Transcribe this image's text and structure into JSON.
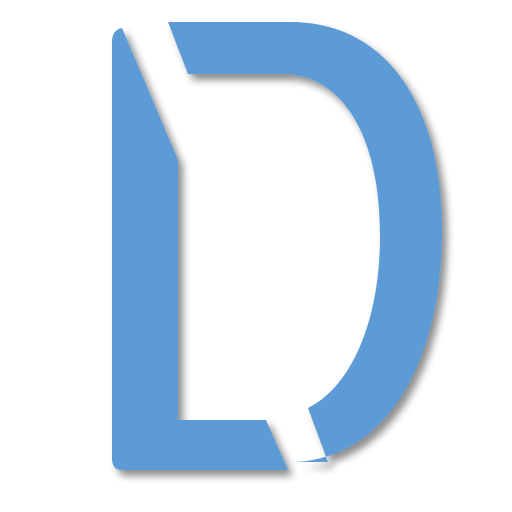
{
  "logo": {
    "icon": "letter-d-logo-icon",
    "fill_color": "#5b9bd5",
    "shadow_color": "#000000",
    "background_color": "#ffffff"
  }
}
